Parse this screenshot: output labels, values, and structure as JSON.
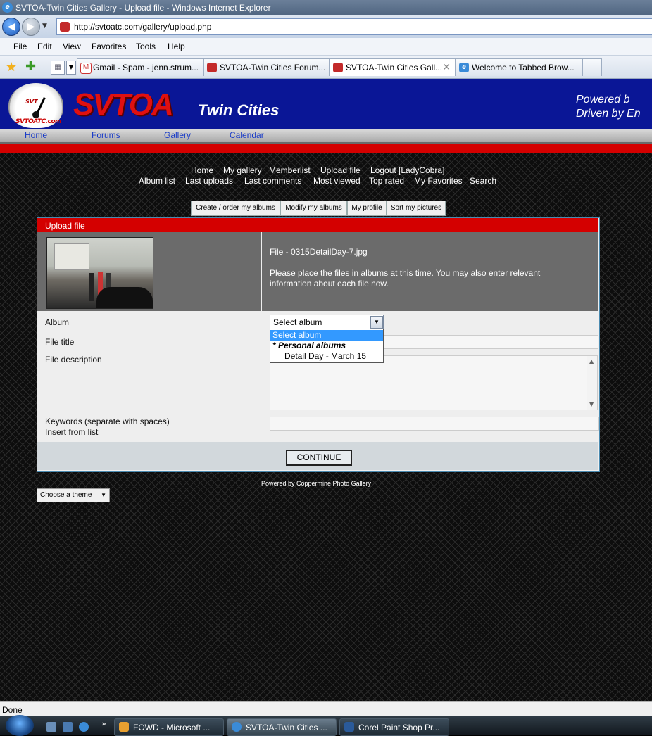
{
  "window": {
    "title": "SVTOA-Twin Cities Gallery - Upload file - Windows Internet Explorer"
  },
  "address": {
    "url": "http://svtoatc.com/gallery/upload.php"
  },
  "menu": [
    "File",
    "Edit",
    "View",
    "Favorites",
    "Tools",
    "Help"
  ],
  "tabs": [
    {
      "label": "Gmail - Spam - jenn.strum...",
      "icon": "gmail-icon",
      "active": false
    },
    {
      "label": "SVTOA-Twin Cities Forum...",
      "icon": "svtoa-icon",
      "active": false
    },
    {
      "label": "SVTOA-Twin Cities Gall...",
      "icon": "svtoa-icon",
      "active": true
    },
    {
      "label": "Welcome to Tabbed Brow...",
      "icon": "ie-icon",
      "active": false
    }
  ],
  "site": {
    "logo": "SVTOA",
    "logo_sub": "Twin Cities",
    "gauge_brand": "SVT",
    "gauge_sub": "SVTOATC.com",
    "powered_line1": "Powered b",
    "powered_line2": "Driven by En",
    "nav": [
      "Home",
      "Forums",
      "Gallery",
      "Calendar"
    ]
  },
  "gallery_nav": {
    "row1": [
      "Home",
      "My gallery",
      "Memberlist",
      "Upload file",
      "Logout [LadyCobra]"
    ],
    "row2": [
      "Album list",
      "Last uploads",
      "Last comments",
      "Most viewed",
      "Top rated",
      "My Favorites",
      "Search"
    ],
    "buttons": [
      "Create / order my albums",
      "Modify my albums",
      "My profile",
      "Sort my pictures"
    ]
  },
  "upload": {
    "header": "Upload file",
    "file_line": "File - 0315DetailDay-7.jpg",
    "instructions_1": "Please place the files in albums at this time. You may also enter relevant",
    "instructions_2": "information about each file now.",
    "album_label": "Album",
    "album_selected": "Select album",
    "album_options": [
      "Select album",
      "* Personal albums",
      "Detail Day - March 15"
    ],
    "title_label": "File title",
    "desc_label": "File description",
    "keywords_label": "Keywords (separate with spaces)",
    "insert_label": "Insert from list",
    "continue": "CONTINUE"
  },
  "footer": {
    "powered": "Powered by Coppermine Photo Gallery",
    "theme": "Choose a theme"
  },
  "status": "Done",
  "taskbar": [
    {
      "label": "FOWD - Microsoft ...",
      "active": false
    },
    {
      "label": "SVTOA-Twin Cities ...",
      "active": true
    },
    {
      "label": "Corel Paint Shop Pr...",
      "active": false
    }
  ]
}
